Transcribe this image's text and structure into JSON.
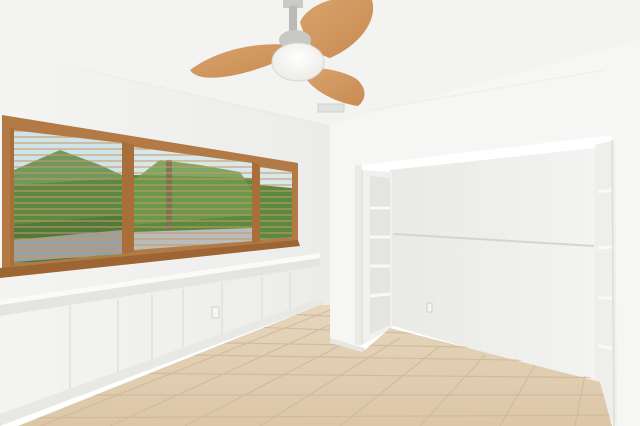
{
  "image": {
    "kind": "photo",
    "subject": "empty-bedroom-interior",
    "elements": [
      "textured-ceiling",
      "ceiling-fan-with-light",
      "window-blinds",
      "wainscot-wall",
      "closet-with-shelves",
      "tile-floor"
    ]
  },
  "colors": {
    "ceiling": "#f3f3f1",
    "wall": "#f6f6f4",
    "wall_shadow": "#e9e9e6",
    "floor": "#e3d2b8",
    "floor_grout": "#cdb99c",
    "wood": "#b37a45",
    "fan_blade": "#d59a5f",
    "blind_slat": "#c89a63",
    "greenery": "#4f7a3a",
    "sky": "#cfe3e8"
  }
}
